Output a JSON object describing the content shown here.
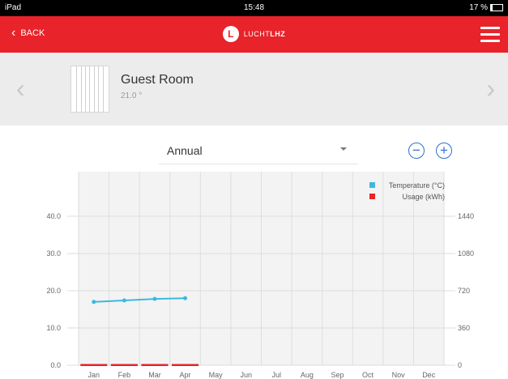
{
  "statusbar": {
    "device": "iPad",
    "time": "15:48",
    "battery": "17 %",
    "battery_level": 0.17
  },
  "navbar": {
    "back_label": "BACK",
    "brand_name": "LUCHT",
    "brand_suffix": "LHZ",
    "brand_mark": "L"
  },
  "room": {
    "name": "Guest Room",
    "temperature": "21.0 °"
  },
  "period": {
    "selected": "Annual"
  },
  "controls": {
    "zoom_out_glyph": "−",
    "zoom_in_glyph": "+"
  },
  "colors": {
    "accent": "#e8232a",
    "temperature": "#3cb8e0",
    "usage": "#e8232a",
    "link": "#2e6fd0"
  },
  "icons": [
    "wifi-icon",
    "battery-icon",
    "chevron-left-icon",
    "brand-logo-icon",
    "hamburger-menu-icon",
    "radiator-icon",
    "chevron-right-icon",
    "dropdown-caret-icon",
    "zoom-out-icon",
    "zoom-in-icon"
  ],
  "chart_data": {
    "type": "line",
    "categories": [
      "Jan",
      "Feb",
      "Mar",
      "Apr",
      "May",
      "Jun",
      "Jul",
      "Aug",
      "Sep",
      "Oct",
      "Nov",
      "Dec"
    ],
    "y_left_ticks": [
      "40.0",
      "30.0",
      "20.0",
      "10.0",
      "0.0"
    ],
    "y_right_ticks": [
      "1440",
      "1080",
      "720",
      "360",
      "0"
    ],
    "ylim_left": [
      0,
      40
    ],
    "ylim_right": [
      0,
      1440
    ],
    "grid": true,
    "legend": "top-right",
    "series": [
      {
        "name": "Temperature (°C)",
        "axis": "left",
        "color": "#3cb8e0",
        "values": [
          17.0,
          17.4,
          17.8,
          18.0,
          null,
          null,
          null,
          null,
          null,
          null,
          null,
          null
        ]
      },
      {
        "name": "Usage (kWh)",
        "axis": "right",
        "color": "#e8232a",
        "values": [
          0,
          0,
          0,
          0,
          null,
          null,
          null,
          null,
          null,
          null,
          null,
          null
        ]
      }
    ]
  }
}
